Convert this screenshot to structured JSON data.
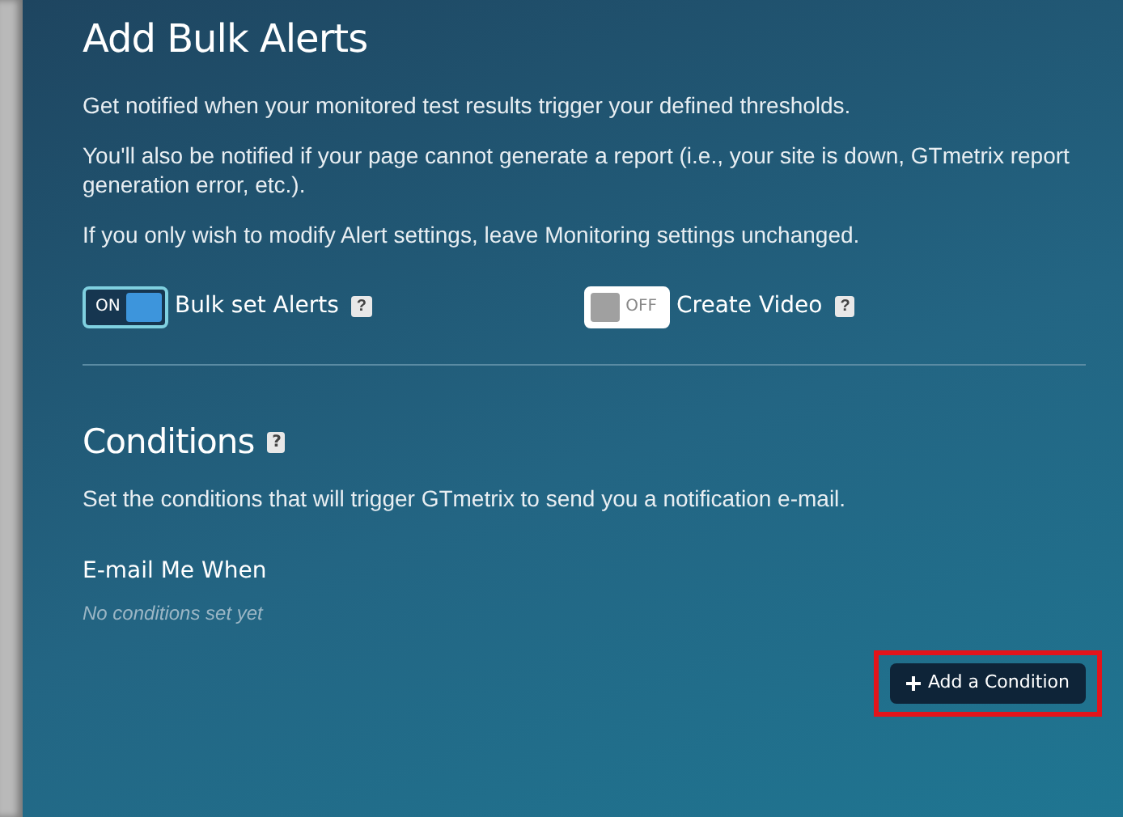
{
  "title": "Add Bulk Alerts",
  "paragraphs": [
    "Get notified when your monitored test results trigger your defined thresholds.",
    "You'll also be notified if your page cannot generate a report (i.e., your site is down, GTmetrix report generation error, etc.).",
    "If you only wish to modify Alert settings, leave Monitoring settings unchanged."
  ],
  "toggles": [
    {
      "label": "Bulk set Alerts",
      "on": true,
      "state_text": "ON",
      "help": "?"
    },
    {
      "label": "Create Video",
      "on": false,
      "state_text": "OFF",
      "help": "?"
    }
  ],
  "conditions": {
    "title": "Conditions",
    "help": "?",
    "description": "Set the conditions that will trigger GTmetrix to send you a notification e-mail.",
    "subheading": "E-mail Me When",
    "empty_text": "No conditions set yet",
    "button": {
      "label": "Add a Condition",
      "highlighted": true
    }
  }
}
